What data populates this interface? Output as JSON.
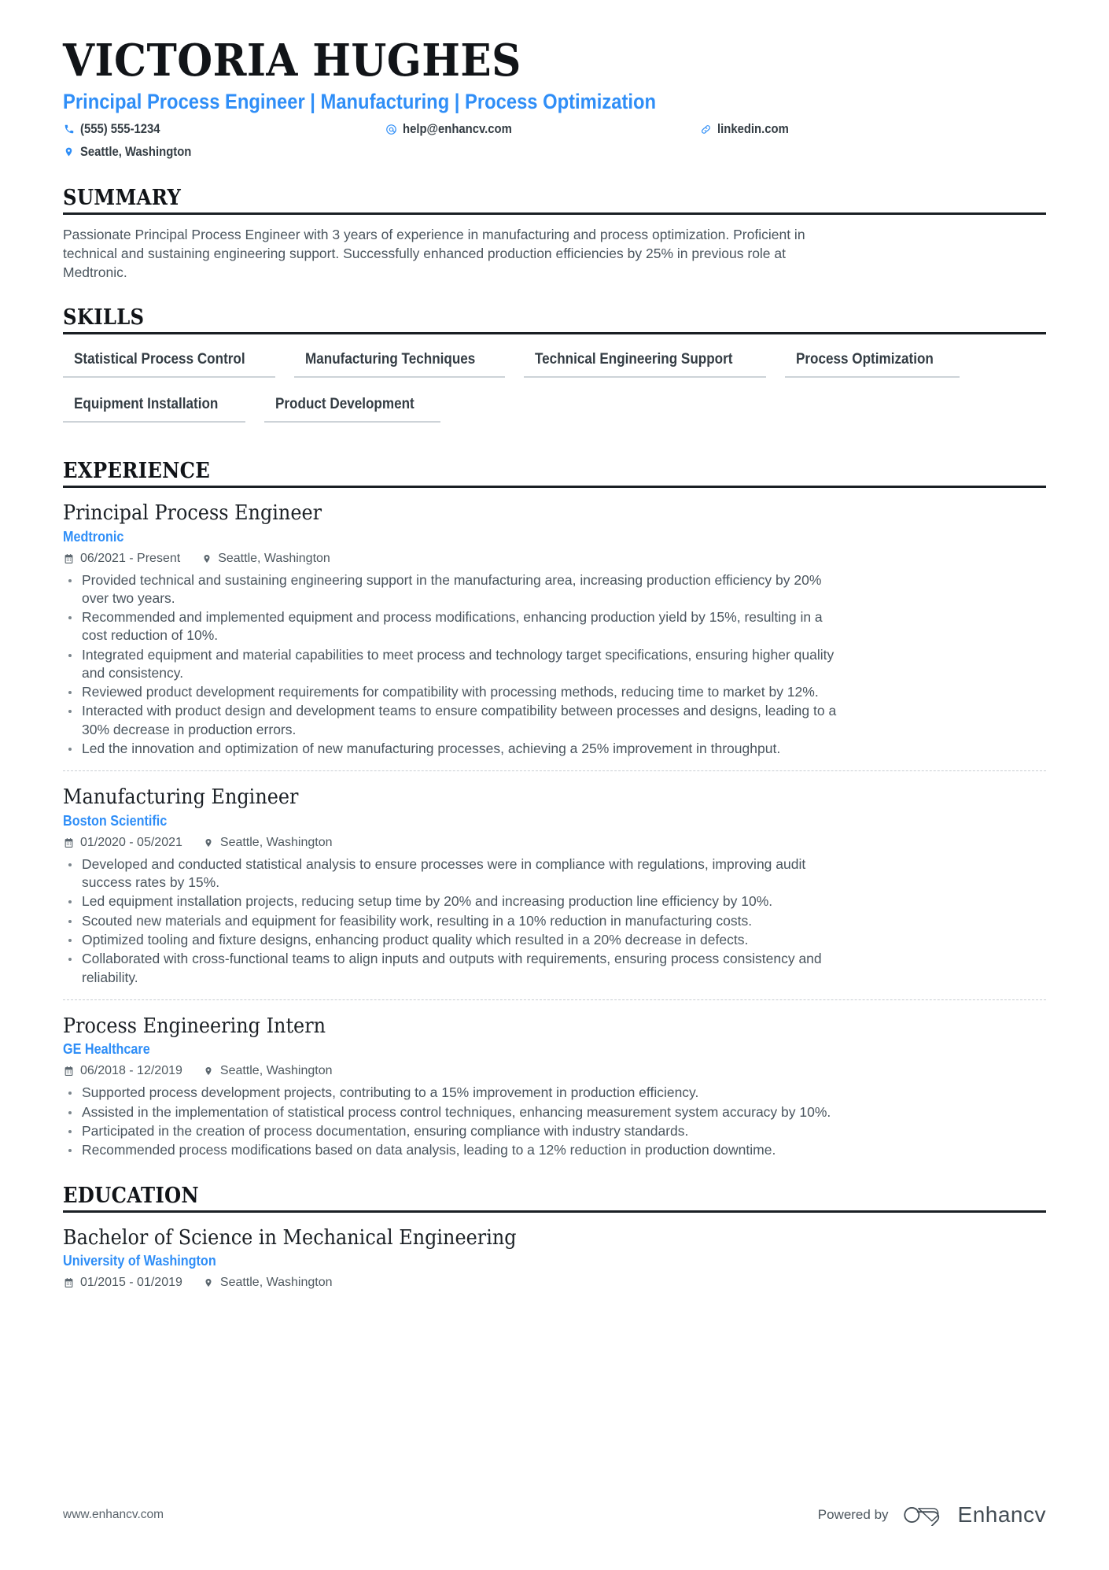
{
  "header": {
    "name": "VICTORIA HUGHES",
    "headline": "Principal Process Engineer | Manufacturing | Process Optimization",
    "contacts": [
      {
        "icon": "phone-icon",
        "value": "(555) 555-1234"
      },
      {
        "icon": "email-icon",
        "value": "help@enhancv.com"
      },
      {
        "icon": "link-icon",
        "value": "linkedin.com"
      },
      {
        "icon": "location-icon",
        "value": "Seattle, Washington"
      }
    ]
  },
  "sections": {
    "summary": {
      "title": "SUMMARY",
      "text": "Passionate Principal Process Engineer with 3 years of experience in manufacturing and process optimization. Proficient in technical and sustaining engineering support. Successfully enhanced production efficiencies by 25% in previous role at Medtronic."
    },
    "skills": {
      "title": "SKILLS",
      "items": [
        "Statistical Process Control",
        "Manufacturing Techniques",
        "Technical Engineering Support",
        "Process Optimization",
        "Equipment Installation",
        "Product Development"
      ]
    },
    "experience": {
      "title": "EXPERIENCE",
      "entries": [
        {
          "title": "Principal Process Engineer",
          "org": "Medtronic",
          "dates": "06/2021 - Present",
          "location": "Seattle, Washington",
          "bullets": [
            "Provided technical and sustaining engineering support in the manufacturing area, increasing production efficiency by 20% over two years.",
            "Recommended and implemented equipment and process modifications, enhancing production yield by 15%, resulting in a cost reduction of 10%.",
            "Integrated equipment and material capabilities to meet process and technology target specifications, ensuring higher quality and consistency.",
            "Reviewed product development requirements for compatibility with processing methods, reducing time to market by 12%.",
            "Interacted with product design and development teams to ensure compatibility between processes and designs, leading to a 30% decrease in production errors.",
            "Led the innovation and optimization of new manufacturing processes, achieving a 25% improvement in throughput."
          ]
        },
        {
          "title": "Manufacturing Engineer",
          "org": "Boston Scientific",
          "dates": "01/2020 - 05/2021",
          "location": "Seattle, Washington",
          "bullets": [
            "Developed and conducted statistical analysis to ensure processes were in compliance with regulations, improving audit success rates by 15%.",
            "Led equipment installation projects, reducing setup time by 20% and increasing production line efficiency by 10%.",
            "Scouted new materials and equipment for feasibility work, resulting in a 10% reduction in manufacturing costs.",
            "Optimized tooling and fixture designs, enhancing product quality which resulted in a 20% decrease in defects.",
            "Collaborated with cross-functional teams to align inputs and outputs with requirements, ensuring process consistency and reliability."
          ]
        },
        {
          "title": "Process Engineering Intern",
          "org": "GE Healthcare",
          "dates": "06/2018 - 12/2019",
          "location": "Seattle, Washington",
          "bullets": [
            "Supported process development projects, contributing to a 15% improvement in production efficiency.",
            "Assisted in the implementation of statistical process control techniques, enhancing measurement system accuracy by 10%.",
            "Participated in the creation of process documentation, ensuring compliance with industry standards.",
            "Recommended process modifications based on data analysis, leading to a 12% reduction in production downtime."
          ]
        }
      ]
    },
    "education": {
      "title": "EDUCATION",
      "entries": [
        {
          "title": "Bachelor of Science in Mechanical Engineering",
          "org": "University of Washington",
          "dates": "01/2015 - 01/2019",
          "location": "Seattle, Washington",
          "bullets": []
        }
      ]
    }
  },
  "footer": {
    "url": "www.enhancv.com",
    "powered_by": "Powered by",
    "brand": "Enhancv"
  },
  "colors": {
    "accent": "#2f8ef7",
    "text": "#4a555e",
    "heading": "#111418",
    "rule": "#1a1f24",
    "skill_underline": "#cdd3d8"
  }
}
